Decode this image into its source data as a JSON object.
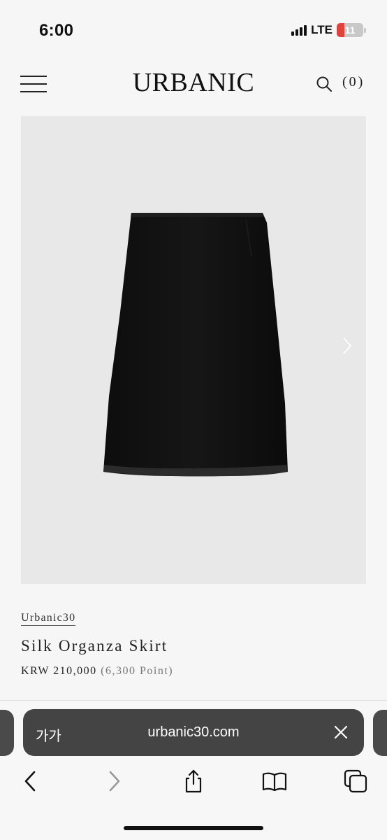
{
  "status_bar": {
    "time": "6:00",
    "network": "LTE",
    "battery": "11",
    "battery_level": 0.11,
    "battery_color": "#e0433b"
  },
  "header": {
    "logo": "URBANIC",
    "cart_count": "(0)",
    "menu_icon": "hamburger-menu-icon",
    "search_icon": "search-icon"
  },
  "product": {
    "image_icon": "black-skirt-photo",
    "next_icon": "chevron-right-icon",
    "brand": "Urbanic30",
    "name": "Silk Organza Skirt",
    "price": "KRW 210,000",
    "points": "(6,300 Point)"
  },
  "browser": {
    "text_size": "가가",
    "url": "urbanic30.com",
    "clear_icon": "close-icon",
    "toolbar": [
      "back-icon",
      "forward-icon",
      "share-icon",
      "bookmarks-icon",
      "tabs-icon"
    ]
  }
}
